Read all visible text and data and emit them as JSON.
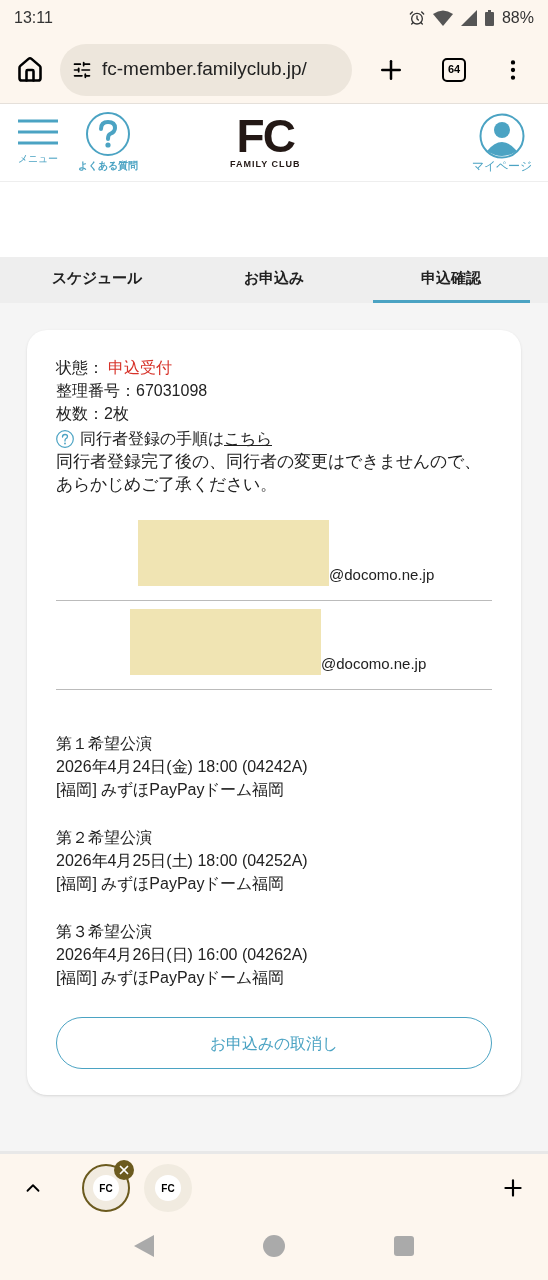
{
  "status_bar": {
    "time": "13:11",
    "battery": "88%"
  },
  "browser": {
    "url": "fc-member.familyclub.jp/",
    "tab_count": "64"
  },
  "header": {
    "menu_label": "メニュー",
    "faq_label": "よくある質問",
    "logo_mark": "FC",
    "logo_text": "FAMILY CLUB",
    "mypage_label": "マイページ"
  },
  "tabs": [
    {
      "label": "スケジュール",
      "selected": false
    },
    {
      "label": "お申込み",
      "selected": false
    },
    {
      "label": "申込確認",
      "selected": true
    }
  ],
  "card": {
    "status_label": "状態：",
    "status_value": "申込受付",
    "number": "整理番号：67031098",
    "tickets": "枚数：2枚",
    "help_text": "同行者登録の手順は",
    "help_link": "こちら",
    "note": "同行者登録完了後の、同行者の変更はできませんので、あらかじめご了承ください。",
    "companions": [
      {
        "masked": true,
        "domain": "@docomo.ne.jp"
      },
      {
        "masked": true,
        "domain": "@docomo.ne.jp"
      }
    ],
    "performances": [
      {
        "title": "第１希望公演",
        "datetime": "2026年4月24日(金) 18:00 (04242A)",
        "venue": "[福岡] みずほPayPayドーム福岡"
      },
      {
        "title": "第２希望公演",
        "datetime": "2026年4月25日(土) 18:00 (04252A)",
        "venue": "[福岡] みずほPayPayドーム福岡"
      },
      {
        "title": "第３希望公演",
        "datetime": "2026年4月26日(日) 16:00 (04262A)",
        "venue": "[福岡] みずほPayPayドーム福岡"
      }
    ],
    "cancel_button": "お申込みの取消し"
  },
  "tab_strip": {
    "tabs": [
      {
        "logo": "FC",
        "selected": true
      },
      {
        "logo": "FC",
        "selected": false
      }
    ]
  }
}
